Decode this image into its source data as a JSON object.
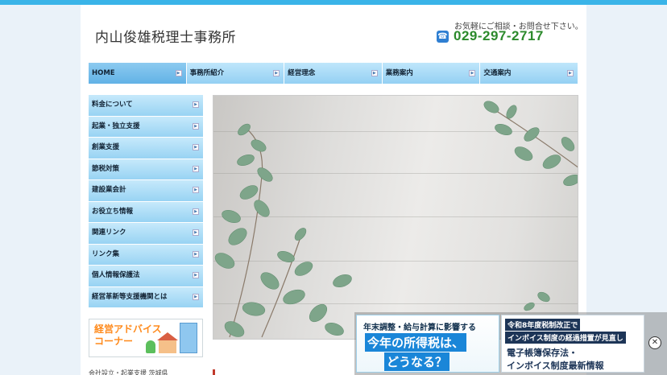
{
  "header": {
    "logo": "内山俊雄税理士事務所",
    "contact_note": "お気軽にご相談・お問合せ下さい。",
    "phone_icon": "phone-icon",
    "phone": "029-297-2717"
  },
  "gnav": [
    {
      "label": "HOME"
    },
    {
      "label": "事務所紹介"
    },
    {
      "label": "経営理念"
    },
    {
      "label": "業務案内"
    },
    {
      "label": "交通案内"
    }
  ],
  "sidebar": [
    {
      "label": "料金について"
    },
    {
      "label": "起業・独立支援"
    },
    {
      "label": "創業支援"
    },
    {
      "label": "節税対策"
    },
    {
      "label": "建設業会計"
    },
    {
      "label": "お役立ち情報"
    },
    {
      "label": "関連リンク"
    },
    {
      "label": "リンク集"
    },
    {
      "label": "個人情報保護法"
    },
    {
      "label": "経営革新等支援機関とは"
    }
  ],
  "banner": {
    "line1": "経営アドバイス",
    "line2": "コーナー"
  },
  "footer_link": "会社設立・起業支援 茨城県",
  "ads": {
    "ad1": {
      "top": "年末調整・給与計算に影響する",
      "main": "今年の所得税は、",
      "sub": "どうなる？"
    },
    "ad2": {
      "l1": "令和8年度税制改正で",
      "l2": "インボイス制度の経過措置が見直し",
      "l3": "電子帳簿保存法・",
      "l4": "インボイス制度最新情報"
    },
    "close": "✕"
  }
}
